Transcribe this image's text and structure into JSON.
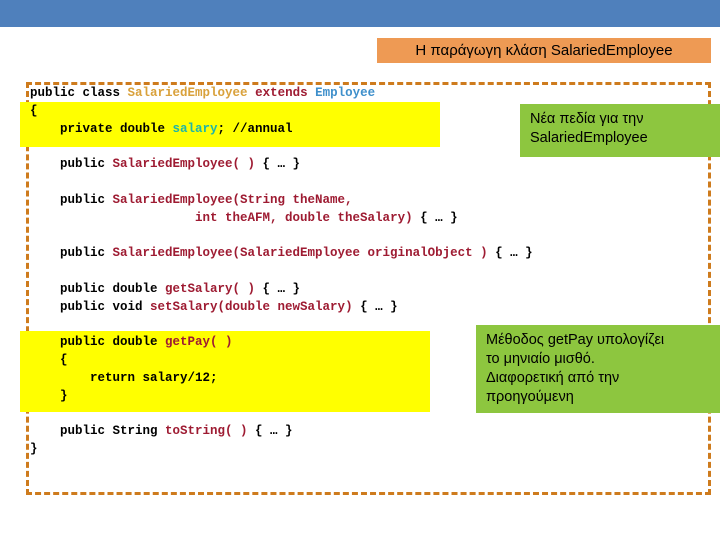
{
  "slide": {
    "title": "Η παράγωγη κλάση SalariedEmployee",
    "title_bg": "#EE9A54",
    "band_color": "#4F80BC",
    "frame_border_color": "#CE7B1D",
    "highlight_color": "#FFFF00",
    "callout_color": "#8DC63F"
  },
  "code": {
    "language": "java",
    "lines": [
      {
        "id": "l01",
        "tokens": [
          {
            "text": "public class ",
            "kind": "plain"
          },
          {
            "text": "SalariedEmployee",
            "kind": "class"
          },
          {
            "text": " extends ",
            "kind": "keyword"
          },
          {
            "text": "Employee",
            "kind": "base"
          }
        ]
      },
      {
        "id": "l02",
        "tokens": [
          {
            "text": "{",
            "kind": "plain"
          }
        ]
      },
      {
        "id": "l03",
        "tokens": [
          {
            "text": "    private double ",
            "kind": "plain"
          },
          {
            "text": "salary",
            "kind": "field"
          },
          {
            "text": "; //annual",
            "kind": "plain"
          }
        ]
      },
      {
        "id": "l04",
        "tokens": [
          {
            "text": " ",
            "kind": "plain"
          }
        ]
      },
      {
        "id": "l05",
        "tokens": [
          {
            "text": "    public ",
            "kind": "plain"
          },
          {
            "text": "SalariedEmployee( )",
            "kind": "method"
          },
          {
            "text": " { … }",
            "kind": "plain"
          }
        ]
      },
      {
        "id": "l06",
        "tokens": [
          {
            "text": " ",
            "kind": "plain"
          }
        ]
      },
      {
        "id": "l07",
        "tokens": [
          {
            "text": "    public ",
            "kind": "plain"
          },
          {
            "text": "SalariedEmployee(String theName,",
            "kind": "method"
          }
        ]
      },
      {
        "id": "l08",
        "tokens": [
          {
            "text": "                      ",
            "kind": "plain"
          },
          {
            "text": "int theAFM, double theSalary)",
            "kind": "method"
          },
          {
            "text": " { … }",
            "kind": "plain"
          }
        ]
      },
      {
        "id": "l09",
        "tokens": [
          {
            "text": " ",
            "kind": "plain"
          }
        ]
      },
      {
        "id": "l10",
        "tokens": [
          {
            "text": "    public ",
            "kind": "plain"
          },
          {
            "text": "SalariedEmployee(SalariedEmployee originalObject )",
            "kind": "method"
          },
          {
            "text": " { … }",
            "kind": "plain"
          }
        ]
      },
      {
        "id": "l11",
        "tokens": [
          {
            "text": " ",
            "kind": "plain"
          }
        ]
      },
      {
        "id": "l12",
        "tokens": [
          {
            "text": "    public double ",
            "kind": "plain"
          },
          {
            "text": "getSalary( )",
            "kind": "method"
          },
          {
            "text": " { … }",
            "kind": "plain"
          }
        ]
      },
      {
        "id": "l13",
        "tokens": [
          {
            "text": "    public void ",
            "kind": "plain"
          },
          {
            "text": "setSalary(double newSalary)",
            "kind": "method"
          },
          {
            "text": " { … }",
            "kind": "plain"
          }
        ]
      },
      {
        "id": "l14",
        "tokens": [
          {
            "text": " ",
            "kind": "plain"
          }
        ]
      },
      {
        "id": "l15",
        "tokens": [
          {
            "text": "    public double ",
            "kind": "plain"
          },
          {
            "text": "getPay( )",
            "kind": "method"
          }
        ]
      },
      {
        "id": "l16",
        "tokens": [
          {
            "text": "    {",
            "kind": "plain"
          }
        ]
      },
      {
        "id": "l17",
        "tokens": [
          {
            "text": "        return salary/12;",
            "kind": "plain"
          }
        ]
      },
      {
        "id": "l18",
        "tokens": [
          {
            "text": "    }",
            "kind": "plain"
          }
        ]
      },
      {
        "id": "l19",
        "tokens": [
          {
            "text": " ",
            "kind": "plain"
          }
        ]
      },
      {
        "id": "l20",
        "tokens": [
          {
            "text": "    public String ",
            "kind": "plain"
          },
          {
            "text": "toString( )",
            "kind": "method"
          },
          {
            "text": " { … }",
            "kind": "plain"
          }
        ]
      },
      {
        "id": "l21",
        "tokens": [
          {
            "text": "}",
            "kind": "plain"
          }
        ]
      }
    ]
  },
  "callouts": {
    "fields": "Νέα πεδία για την\nSalariedEmployee",
    "getpay": "Μέθοδος getPay υπολογίζει\nτο μηνιαίο μισθό.\nΔιαφορετική από την\nπροηγούμενη"
  }
}
